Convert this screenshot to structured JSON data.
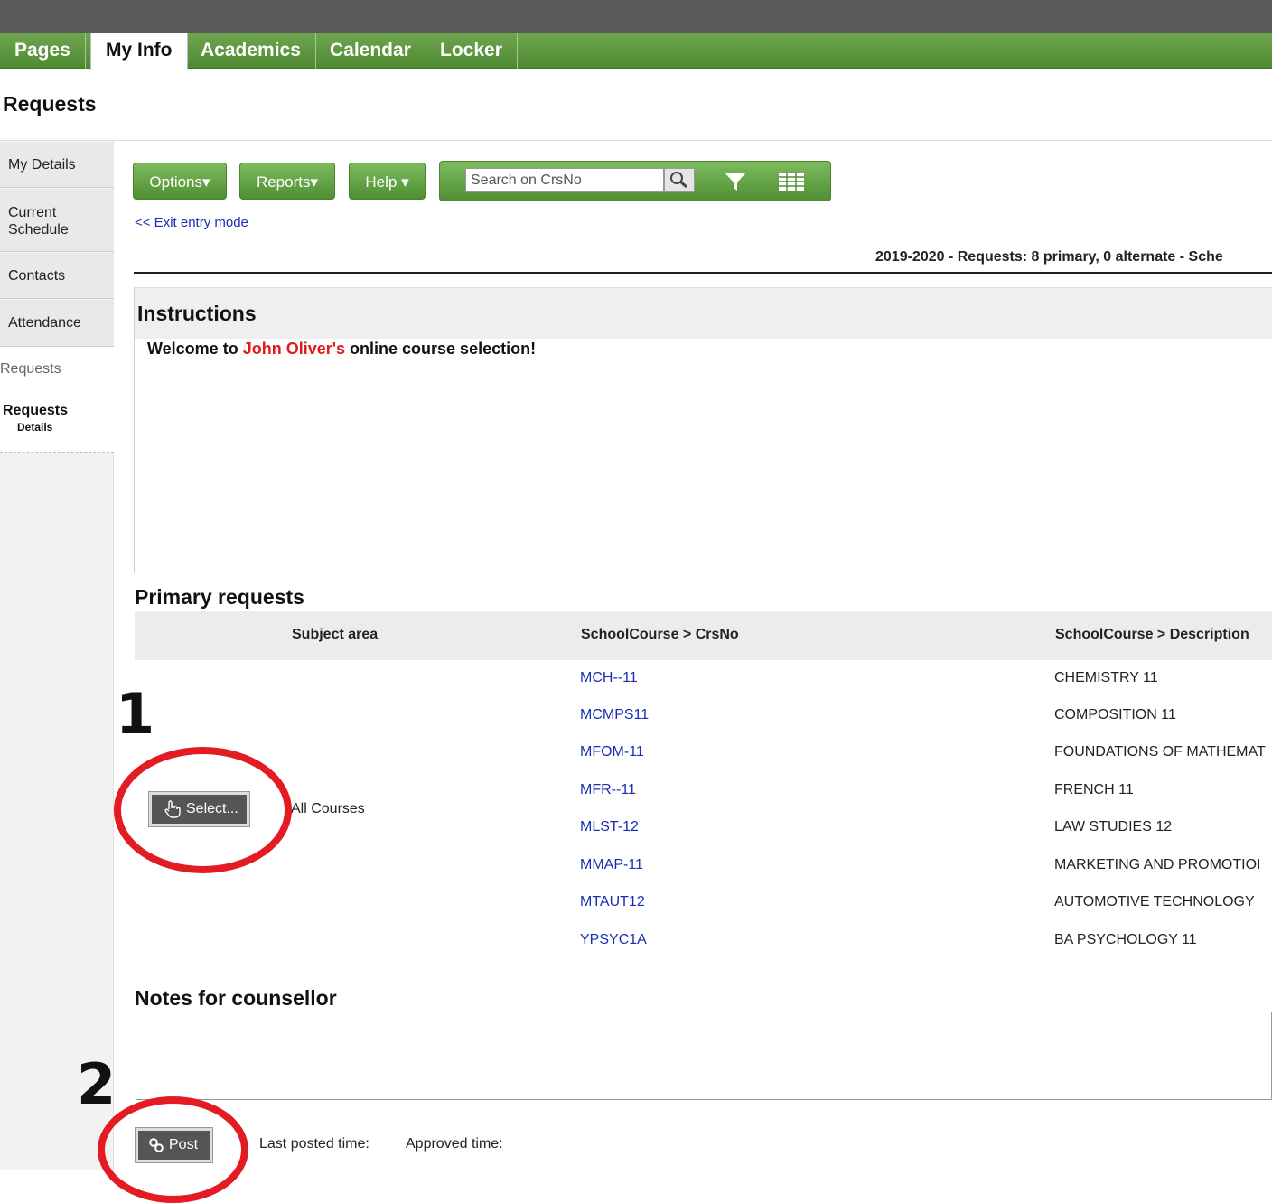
{
  "nav": {
    "tabs": [
      {
        "label": "Pages"
      },
      {
        "label": "My Info"
      },
      {
        "label": "Academics"
      },
      {
        "label": "Calendar"
      },
      {
        "label": "Locker"
      }
    ]
  },
  "page": {
    "title": "Requests"
  },
  "sidebar": {
    "items": [
      {
        "label": "My Details"
      },
      {
        "label": "Current\nSchedule"
      },
      {
        "label": "Contacts"
      },
      {
        "label": "Attendance"
      }
    ],
    "sub_label": "Requests",
    "active_label": "Requests",
    "active_detail": "Details"
  },
  "toolbar": {
    "options_label": "Options",
    "reports_label": "Reports",
    "help_label": "Help",
    "search_placeholder": "Search on CrsNo"
  },
  "exit_link": "<< Exit entry mode",
  "summary": "2019-2020 - Requests: 8 primary, 0 alternate - Sche",
  "instructions": {
    "title": "Instructions",
    "text_before": "Welcome to ",
    "school": "John Oliver's",
    "text_after": " online course selection!"
  },
  "primary": {
    "title": "Primary requests",
    "headers": {
      "subject": "Subject area",
      "crsno": "SchoolCourse > CrsNo",
      "description": "SchoolCourse > Description"
    },
    "select_label": "Select...",
    "subject_value": "All Courses",
    "rows": [
      {
        "crsno": "MCH--11",
        "description": "CHEMISTRY 11"
      },
      {
        "crsno": "MCMPS11",
        "description": "COMPOSITION 11"
      },
      {
        "crsno": "MFOM-11",
        "description": "FOUNDATIONS OF MATHEMAT"
      },
      {
        "crsno": "MFR--11",
        "description": "FRENCH 11"
      },
      {
        "crsno": "MLST-12",
        "description": "LAW STUDIES 12"
      },
      {
        "crsno": "MMAP-11",
        "description": "MARKETING AND PROMOTIOI"
      },
      {
        "crsno": "MTAUT12",
        "description": "AUTOMOTIVE TECHNOLOGY"
      },
      {
        "crsno": "YPSYC1A",
        "description": "BA PSYCHOLOGY 11"
      }
    ]
  },
  "notes": {
    "title": "Notes for counsellor"
  },
  "footer": {
    "post_label": "Post",
    "last_posted": "Last posted time:",
    "approved": "Approved time:"
  },
  "annotations": {
    "one": "1",
    "two": "2",
    "ring_color": "#e31b23"
  },
  "colors": {
    "tab_green": "#5c9a3d",
    "link_blue": "#1a2db5",
    "school_red": "#e01b1b"
  }
}
